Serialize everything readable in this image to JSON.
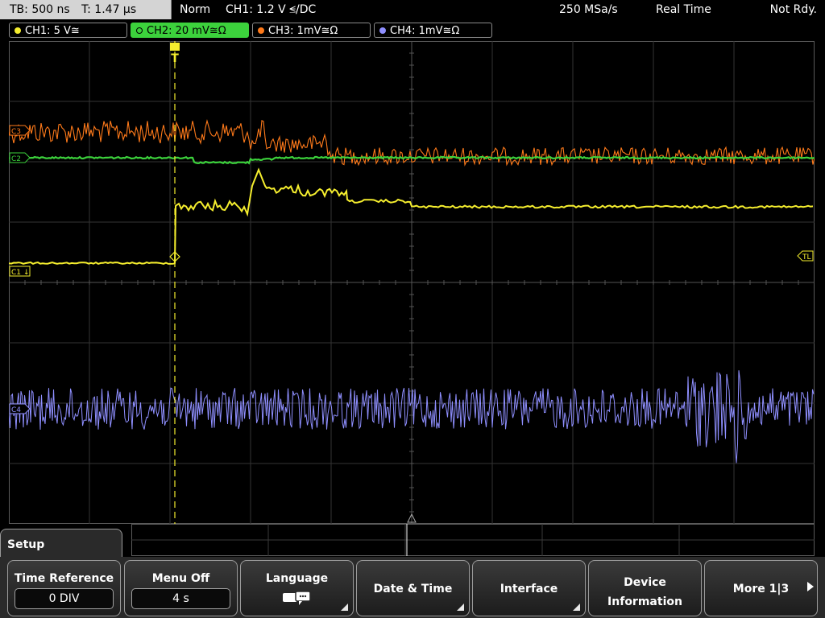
{
  "top_bar": {
    "timebase": "TB: 500 ns",
    "trigger_time": "T: 1.47 µs",
    "trigger_mode": "Norm",
    "trigger_info": "CH1: 1.2 V ⪬/DC",
    "sample_rate": "250 MSa/s",
    "acq_mode": "Real Time",
    "status": "Not Rdy."
  },
  "channels": [
    {
      "label": "CH1: 5 V≅",
      "color": "#f5ee2e",
      "marker": "C1"
    },
    {
      "label": "CH2: 20 mV≅Ω",
      "color": "#3cd23c",
      "marker": "C2"
    },
    {
      "label": "CH3: 1mV≅Ω",
      "color": "#ff7a1a",
      "marker": "C3"
    },
    {
      "label": "CH4: 1mV≅Ω",
      "color": "#8f8fff",
      "marker": "C4"
    }
  ],
  "waveform_markers": {
    "trigger_level": "TL",
    "trigger_position": "T"
  },
  "menu": {
    "title": "Setup",
    "softkeys": [
      {
        "label": "Time Reference",
        "value": "0 DIV"
      },
      {
        "label": "Menu Off",
        "value": "4 s"
      },
      {
        "label": "Language"
      },
      {
        "label": "Date & Time"
      },
      {
        "label": "Interface"
      },
      {
        "label_line1": "Device",
        "label_line2": "Information"
      },
      {
        "label": "More 1|3"
      }
    ]
  },
  "colors": {
    "ch1": "#f5ee2e",
    "ch2": "#3cd23c",
    "ch3": "#ff7a1a",
    "ch4": "#8f8fff",
    "grid": "#3a3a3a"
  }
}
